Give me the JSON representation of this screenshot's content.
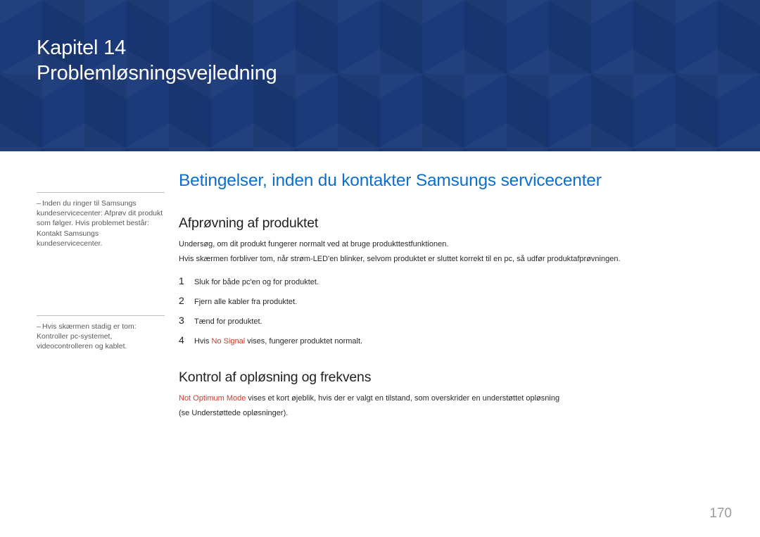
{
  "header": {
    "chapter_line": "Kapitel 14",
    "chapter_title": "Problemløsningsvejledning"
  },
  "sidebar": {
    "note1": "Inden du ringer til Samsungs kundeservicecenter: Afprøv dit produkt som følger. Hvis problemet består: Kontakt Samsungs kundeservicecenter.",
    "note2": "Hvis skærmen stadig er tom: Kontroller pc-systemet, videocontrolleren og kablet."
  },
  "main": {
    "section_heading": "Betingelser, inden du kontakter Samsungs servicecenter",
    "sub1": {
      "heading": "Afprøvning af produktet",
      "p1": "Undersøg, om dit produkt fungerer normalt ved at bruge produkttestfunktionen.",
      "p2": "Hvis skærmen forbliver tom, når strøm-LED'en blinker, selvom produktet er sluttet korrekt til en pc, så udfør produktafprøvningen.",
      "steps": [
        {
          "n": "1",
          "text": "Sluk for både pc'en og for produktet."
        },
        {
          "n": "2",
          "text": "Fjern alle kabler fra produktet."
        },
        {
          "n": "3",
          "text": "Tænd for produktet."
        },
        {
          "n": "4",
          "prefix": "Hvis ",
          "red": "No Signal",
          "suffix": " vises, fungerer produktet normalt."
        }
      ]
    },
    "sub2": {
      "heading": "Kontrol af opløsning og frekvens",
      "red": "Not Optimum Mode",
      "p1_suffix": " vises et kort øjeblik, hvis der er valgt en tilstand, som overskrider en understøttet opløsning",
      "p2": "(se Understøttede opløsninger)."
    }
  },
  "page_number": "170"
}
